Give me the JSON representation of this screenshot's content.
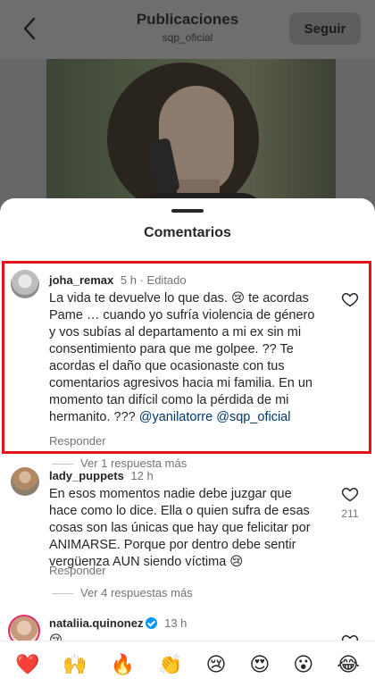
{
  "header": {
    "title": "Publicaciones",
    "subtitle": "sqp_oficial",
    "follow_label": "Seguir"
  },
  "sheet": {
    "title": "Comentarios"
  },
  "comments": [
    {
      "username": "joha_remax",
      "time": "5 h",
      "edited": "· Editado",
      "text_main": "La vida te devuelve lo que das. 😢 te acordas Pame … cuando yo sufría violencia de género y vos subías al departamento a mi ex sin mi consentimiento para que me golpee. ?? Te acordas el daño que ocasionaste con tus comentarios agresivos hacia mi familia. En un momento tan difícil como la pérdida de mi hermanito. ??? ",
      "mention1": "@yanilatorre",
      "mention2": "@sqp_oficial",
      "reply_label": "Responder",
      "more_replies": "Ver 1 respuesta más"
    },
    {
      "username": "lady_puppets",
      "time": "12 h",
      "text": "En esos momentos nadie debe juzgar que hace como lo dice. Ella o quien sufra de esas cosas son las únicas que hay que felicitar por ANIMARSE. Porque por dentro debe sentir vergüenza AUN siendo víctima 😢",
      "likes": "211",
      "reply_label": "Responder",
      "more_replies": "Ver 4 respuestas más"
    },
    {
      "username": "nataliia.quinonez",
      "time": "13 h",
      "text": "😢"
    }
  ],
  "emoji_bar": [
    "❤️",
    "🙌",
    "🔥",
    "👏",
    "😢",
    "😍",
    "😮",
    "😂"
  ],
  "icons": {
    "back": "chevron-left-icon",
    "like": "heart-outline-icon",
    "verified": "verified-badge-icon"
  },
  "colors": {
    "highlight_box": "#e3121b",
    "mention": "#00376b",
    "verified": "#0095f6"
  }
}
